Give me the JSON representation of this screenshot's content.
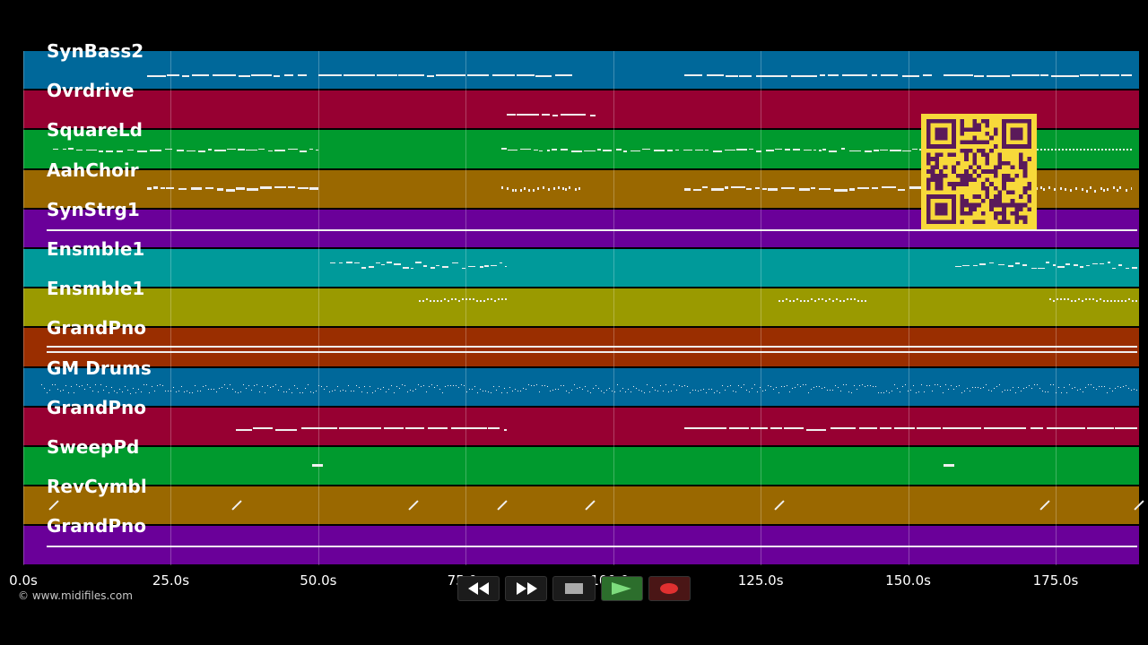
{
  "tracks": [
    {
      "name": "SynBass2",
      "color": "#00689a"
    },
    {
      "name": "Ovrdrive",
      "color": "#970032"
    },
    {
      "name": "SquareLd",
      "color": "#009a2e"
    },
    {
      "name": "AahChoir",
      "color": "#9a6800"
    },
    {
      "name": "SynStrg1",
      "color": "#6a0099"
    },
    {
      "name": "Ensmble1",
      "color": "#009a9a"
    },
    {
      "name": "Ensmble1",
      "color": "#9a9a00"
    },
    {
      "name": "GrandPno",
      "color": "#9a2e00"
    },
    {
      "name": "GM Drums",
      "color": "#00689a"
    },
    {
      "name": "GrandPno",
      "color": "#970032"
    },
    {
      "name": "SweepPd",
      "color": "#009a2e"
    },
    {
      "name": "RevCymbl",
      "color": "#9a6800"
    },
    {
      "name": "GrandPno",
      "color": "#6a0099"
    }
  ],
  "timeline": {
    "ticks": [
      "0.0s",
      "25.0s",
      "50.0s",
      "75.0s",
      "100.0s",
      "125.0s",
      "150.0s",
      "175.0s"
    ]
  },
  "copyright": "© www.midifiles.com",
  "controls": {
    "rewind": "rewind-icon",
    "fast_forward": "fast-forward-icon",
    "stop": "stop-icon",
    "play": "play-icon",
    "record": "record-icon"
  },
  "qr_icon": "qr-code-icon"
}
